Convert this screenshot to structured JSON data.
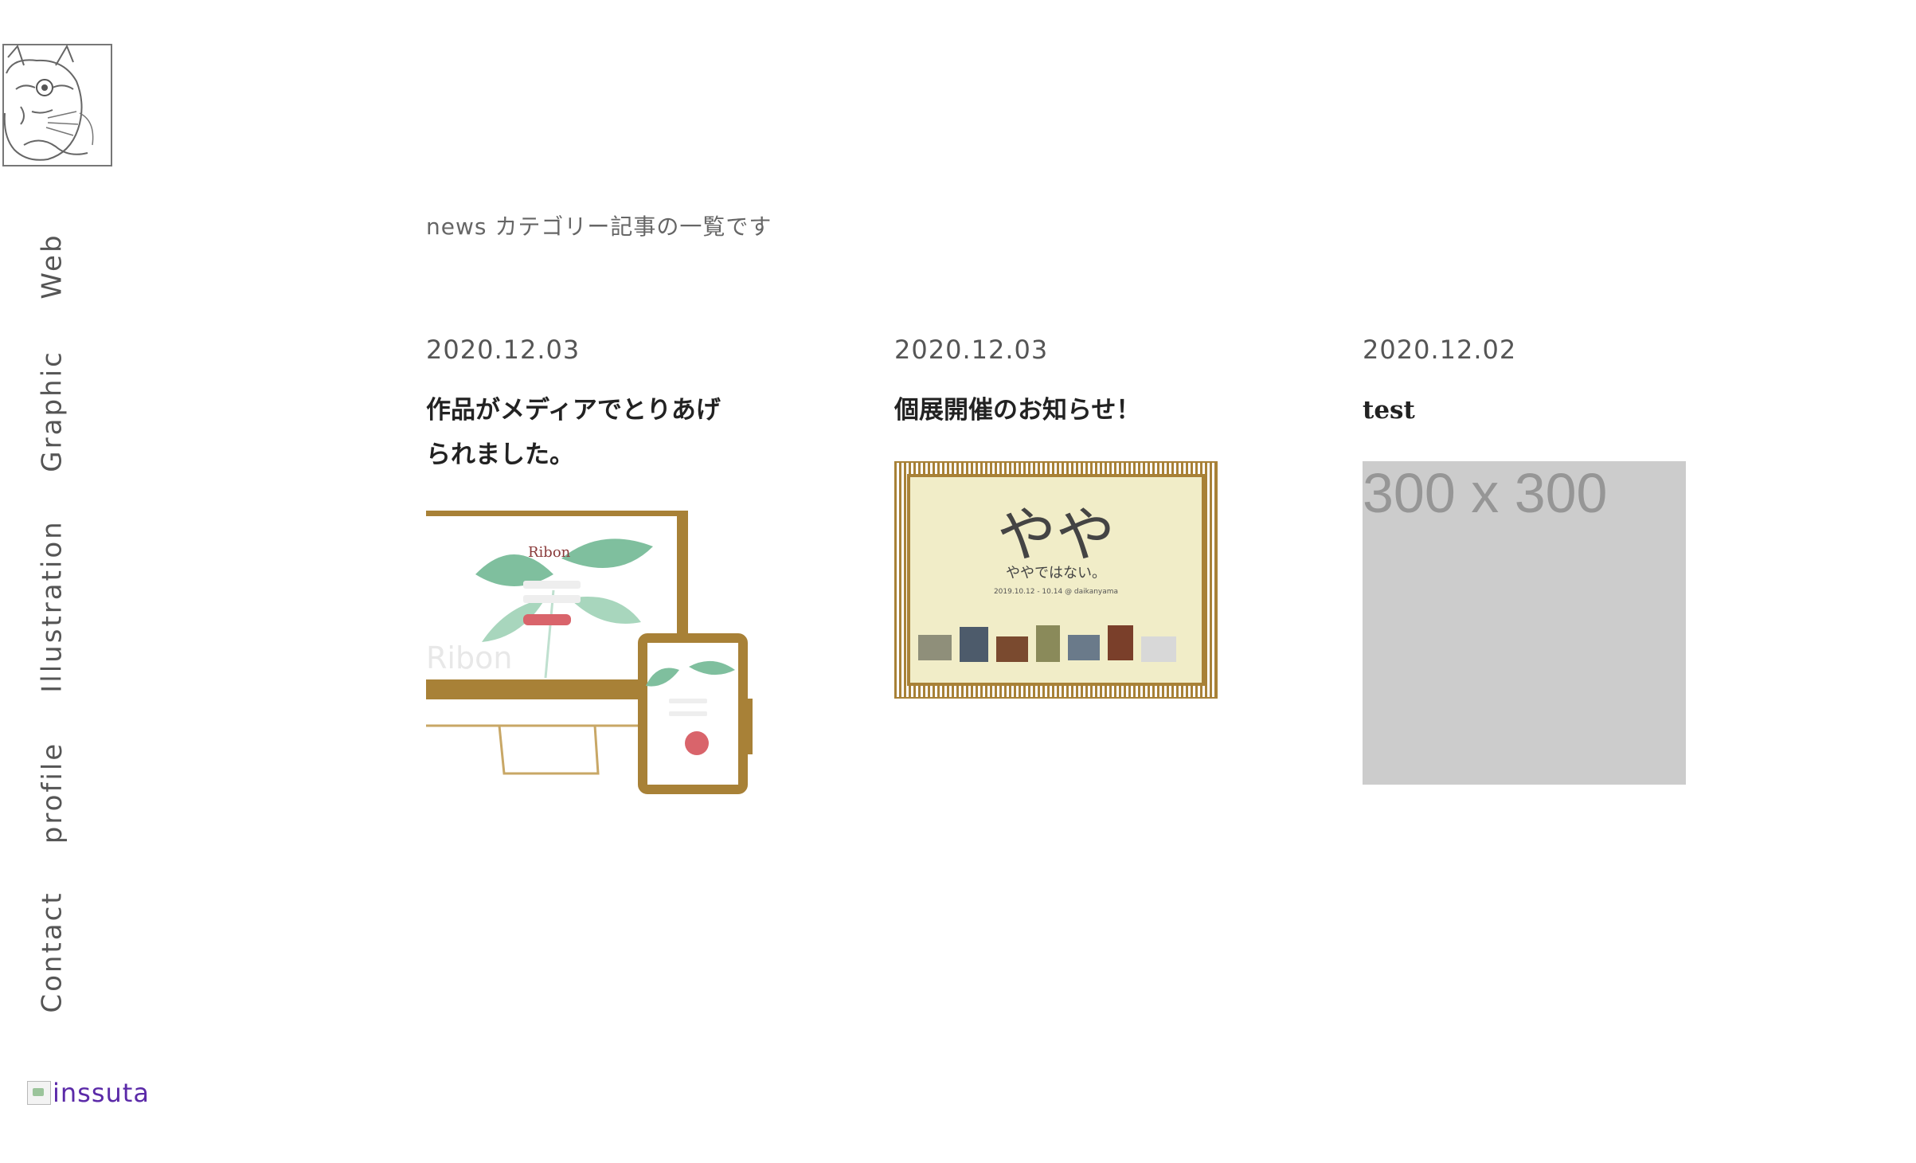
{
  "nav": {
    "items": [
      {
        "label": "Web"
      },
      {
        "label": "Graphic"
      },
      {
        "label": "Illustration"
      },
      {
        "label": "profile"
      },
      {
        "label": "Contact"
      }
    ],
    "instagram_alt": "inssuta"
  },
  "main": {
    "heading": "news カテゴリー記事の一覧です",
    "posts": [
      {
        "date": "2020.12.03",
        "title": "作品がメディアでとりあげられました。",
        "image_text": "Ribon",
        "image_subtext": "Ribon"
      },
      {
        "date": "2020.12.03",
        "title": "個展開催のお知らせ！",
        "image_text": "やや",
        "image_subtext": "ややではない。",
        "image_caption": "2019.10.12 - 10.14 @ daikanyama"
      },
      {
        "date": "2020.12.02",
        "title": "test",
        "image_text": "300 x 300"
      }
    ]
  },
  "colors": {
    "frame_gold": "#a88137",
    "leaf_green": "#7fbf9e",
    "poster_bg": "#f1edc8",
    "placeholder_bg": "#cccccc",
    "link_purple": "#5b2aa8"
  }
}
